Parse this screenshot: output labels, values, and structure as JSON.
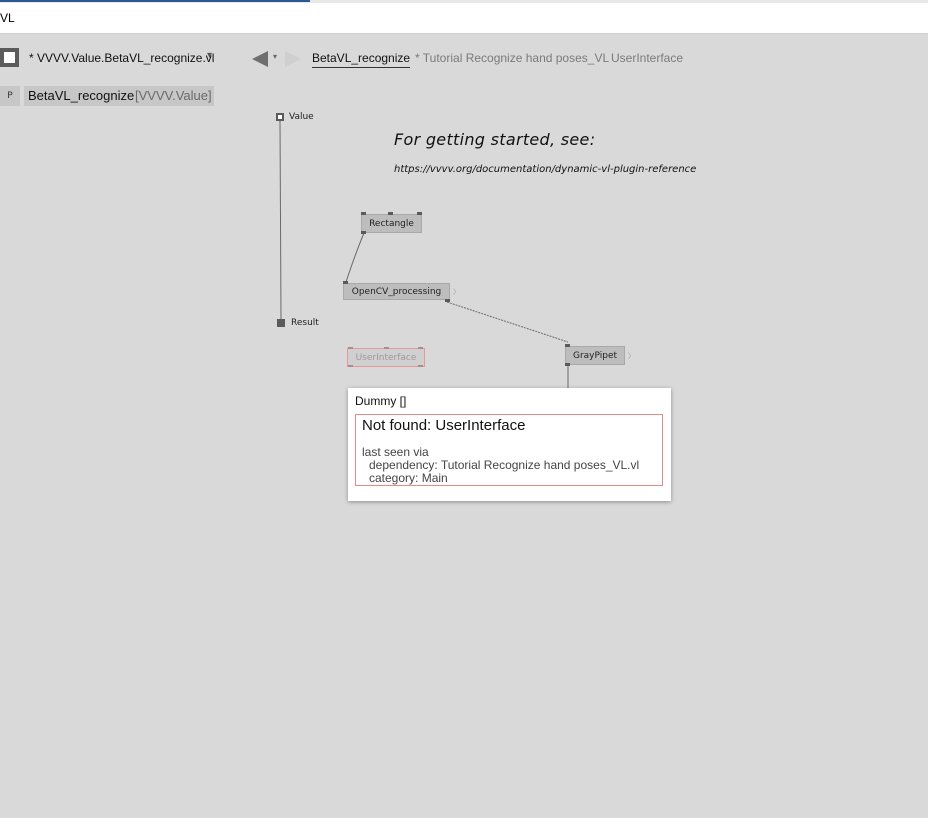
{
  "window": {
    "title": "VL"
  },
  "tabs": {
    "document": "* VVVV.Value.BetaVL_recognize.vl",
    "dropdown_glyph": "▾",
    "active": "BetaVL_recognize",
    "inactive_1": "* Tutorial Recognize hand poses_VL",
    "inactive_2": "UserInterface"
  },
  "breadcrumb": {
    "marker": "P",
    "name": "BetaVL_recognize",
    "category": "[VVVV.Value]"
  },
  "patch": {
    "input_pin": "Value",
    "output_pin": "Result",
    "comment_title": "For getting started, see:",
    "comment_url": "https://vvvv.org/documentation/dynamic-vl-plugin-reference",
    "nodes": {
      "rectangle": "Rectangle",
      "opencv": "OpenCV_processing",
      "userinterface": "UserInterface",
      "graypipet": "GrayPipet"
    }
  },
  "tooltip": {
    "title": "Dummy []",
    "error": "Not found: UserInterface",
    "line1": "last seen via",
    "line2": "dependency: Tutorial Recognize hand poses_VL.vl",
    "line3": "category: Main"
  },
  "colors": {
    "canvas": "#d9d9d9",
    "node": "#bdbdbd",
    "error_border": "#e58a8a"
  }
}
